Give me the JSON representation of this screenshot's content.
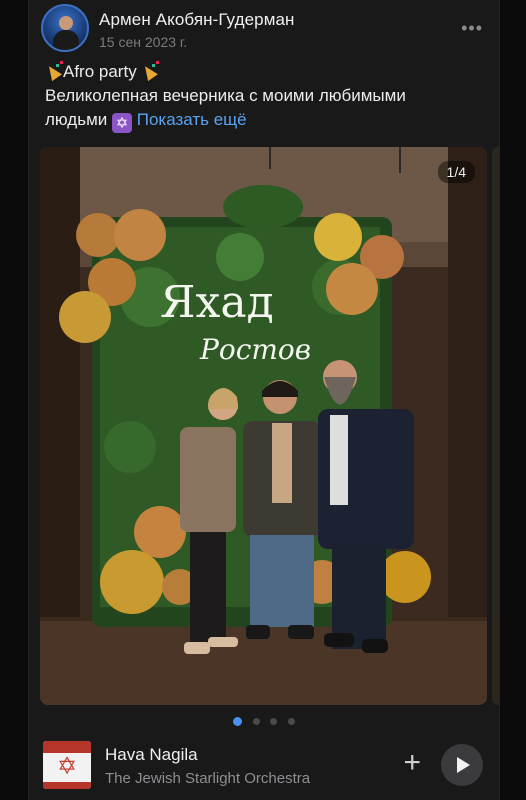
{
  "post": {
    "author": "Армен Акобян-Гудерман",
    "date": "15 сен 2023 г.",
    "text_line1": "Afro party",
    "text_line2": "Великолепная вечерника с моими любимыми",
    "text_line3": "людьми",
    "show_more": "Показать ещё",
    "star_glyph": "✡"
  },
  "media": {
    "counter": "1/4",
    "neon_sign": "Яхад",
    "neon_script": "Ростов",
    "slides_total": 4,
    "active_slide": 1
  },
  "audio": {
    "title": "Hava Nagila",
    "artist": "The Jewish Starlight Orchestra",
    "add_glyph": "+"
  },
  "colors": {
    "link": "#5aa2f0",
    "active_dot": "#4b8ff0",
    "card_bg": "#191919"
  },
  "icons": [
    "more-icon",
    "party-popper-icon",
    "star-of-david-icon",
    "add-icon",
    "play-icon"
  ]
}
